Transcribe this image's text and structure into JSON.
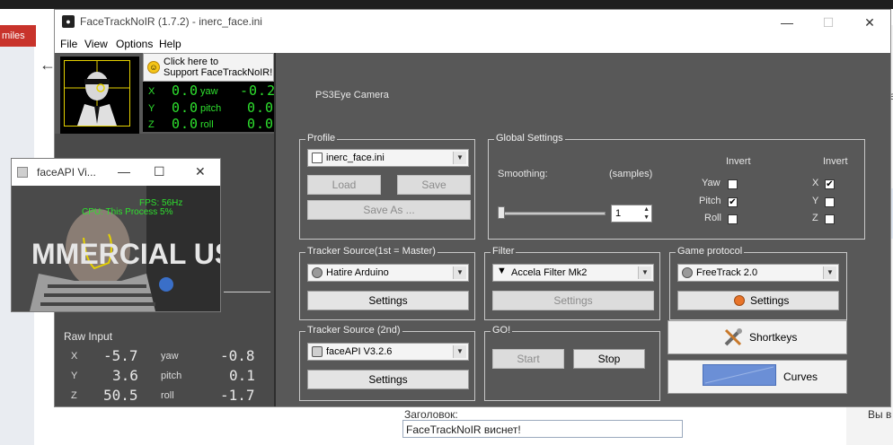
{
  "background": {
    "left_tab_label": "miles",
    "right_label": "ve",
    "zag_label": "Заголовок:",
    "vy_label": "Вы в",
    "title_input_value": "FaceTrackNoIR виснет!"
  },
  "main_window": {
    "title": "FaceTrackNoIR (1.7.2) - inerc_face.ini",
    "menu": [
      "File",
      "View",
      "Options",
      "Help"
    ],
    "support_button": {
      "line1": "Click here to",
      "line2": "Support FaceTrackNoIR!"
    },
    "headpose": {
      "rows": [
        {
          "axis": "X",
          "val": "0.0",
          "rot": "yaw",
          "rotval": "-0.2"
        },
        {
          "axis": "Y",
          "val": "0.0",
          "rot": "pitch",
          "rotval": "0.0"
        },
        {
          "axis": "Z",
          "val": "0.0",
          "rot": "roll",
          "rotval": "0.0"
        }
      ]
    },
    "raw_input": {
      "title": "Raw Input",
      "rows": [
        {
          "axis": "X",
          "val": "-5.7",
          "rot": "yaw",
          "rotval": "-0.8"
        },
        {
          "axis": "Y",
          "val": "3.6",
          "rot": "pitch",
          "rotval": "0.1"
        },
        {
          "axis": "Z",
          "val": "50.5",
          "rot": "roll",
          "rotval": "-1.7"
        }
      ]
    },
    "camera_label": "PS3Eye Camera",
    "profile": {
      "label": "Profile",
      "selected": "inerc_face.ini",
      "load": "Load",
      "save": "Save",
      "save_as": "Save As ..."
    },
    "global_settings": {
      "label": "Global Settings",
      "smoothing": "Smoothing:",
      "samples": "(samples)",
      "smoothing_value": "1",
      "invert_label": "Invert",
      "rot_axes": [
        {
          "name": "Yaw",
          "checked": false
        },
        {
          "name": "Pitch",
          "checked": true
        },
        {
          "name": "Roll",
          "checked": false
        }
      ],
      "pos_axes": [
        {
          "name": "X",
          "checked": true
        },
        {
          "name": "Y",
          "checked": false
        },
        {
          "name": "Z",
          "checked": false
        }
      ]
    },
    "tracker_source_1": {
      "label": "Tracker Source(1st = Master)",
      "selected": "Hatire Arduino",
      "settings": "Settings"
    },
    "filter": {
      "label": "Filter",
      "selected": "Accela Filter Mk2",
      "settings": "Settings"
    },
    "game_protocol": {
      "label": "Game protocol",
      "selected": "FreeTrack 2.0",
      "settings": "Settings"
    },
    "tracker_source_2": {
      "label": "Tracker Source (2nd)",
      "selected": "faceAPI V3.2.6",
      "settings": "Settings"
    },
    "go": {
      "label": "GO!",
      "start": "Start",
      "stop": "Stop"
    },
    "shortkeys": "Shortkeys",
    "curves": "Curves"
  },
  "faceapi_window": {
    "title": "faceAPI Vi...",
    "overlay_fps": "FPS: 56Hz",
    "overlay_cpu": "CPU: This Process 5%",
    "overlay_watermark": "MMERCIAL US"
  }
}
